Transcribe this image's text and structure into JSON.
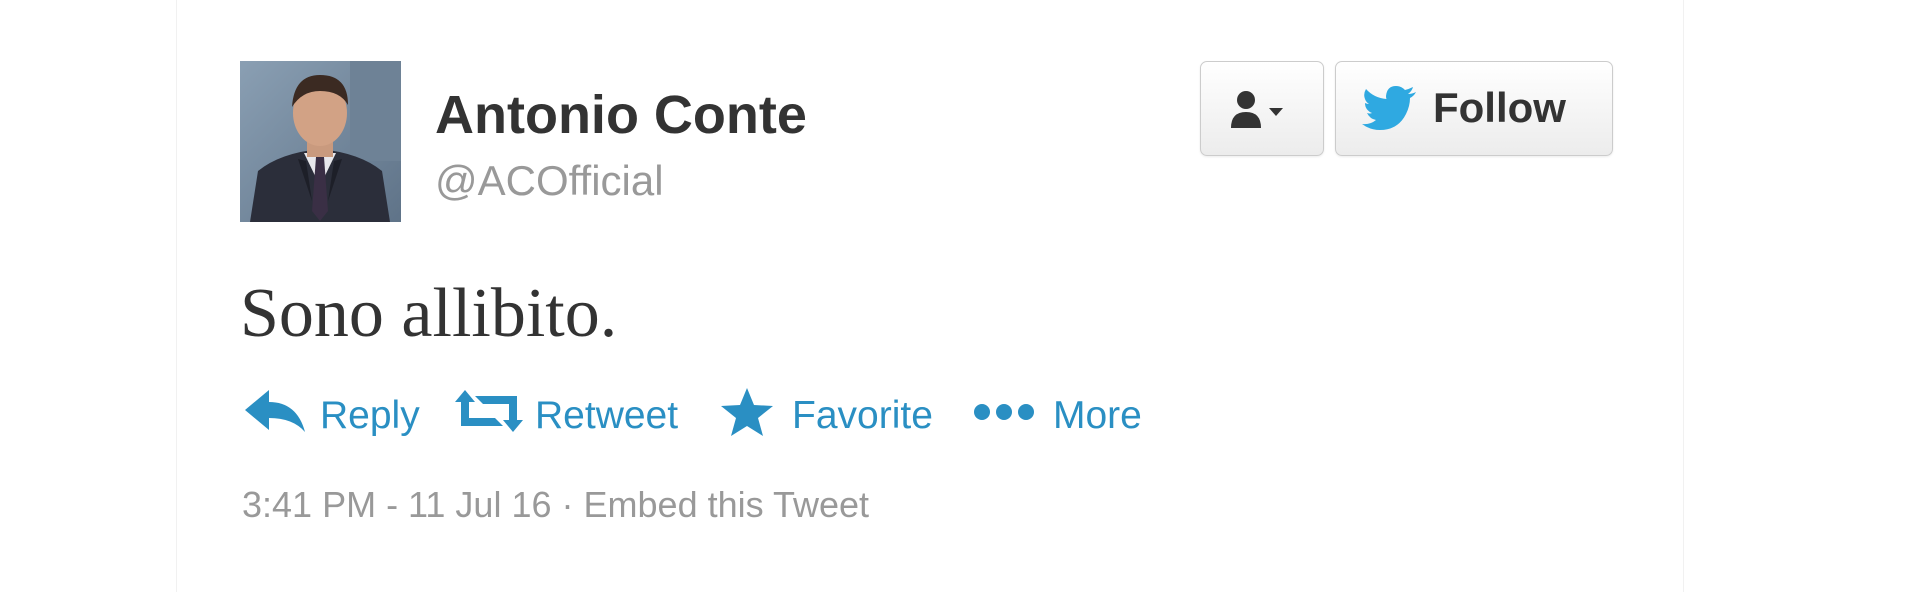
{
  "tweet": {
    "author": {
      "name": "Antonio Conte",
      "handle": "@ACOfficial"
    },
    "text": "Sono allibito.",
    "timestamp": "3:41 PM - 11 Jul 16",
    "separator": "·",
    "embed_label": "Embed this Tweet"
  },
  "buttons": {
    "follow_label": "Follow"
  },
  "actions": {
    "reply": "Reply",
    "retweet": "Retweet",
    "favorite": "Favorite",
    "more": "More"
  },
  "icons": {
    "user_menu": "user-dropdown-icon",
    "bird": "twitter-bird-icon",
    "reply": "reply-arrow-icon",
    "retweet": "retweet-icon",
    "favorite": "star-icon",
    "more": "dots-icon"
  },
  "colors": {
    "link": "#2a8fc3",
    "twitter_blue": "#2fa9e1",
    "name": "#333333",
    "muted": "#999999"
  }
}
